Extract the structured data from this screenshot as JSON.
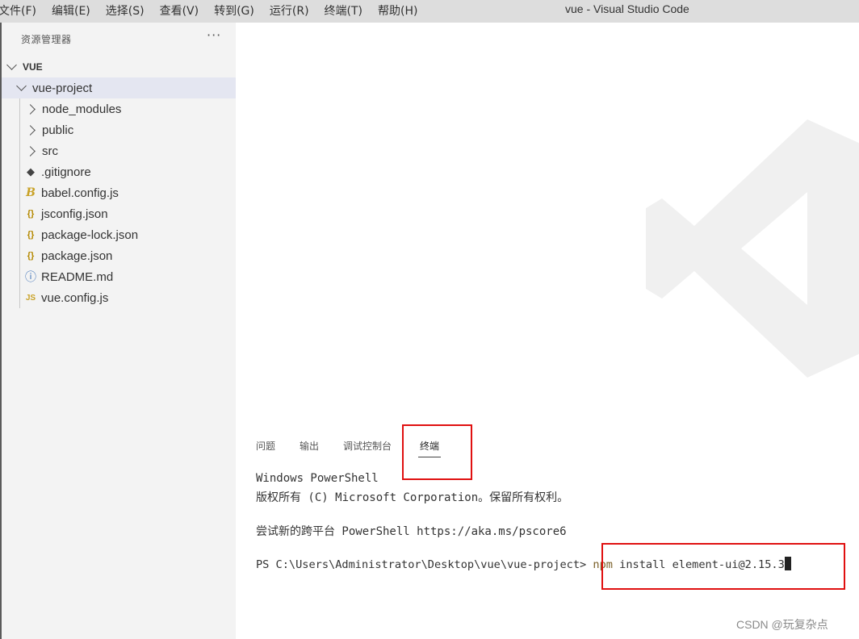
{
  "menu": {
    "items": [
      "文件(F)",
      "编辑(E)",
      "选择(S)",
      "查看(V)",
      "转到(G)",
      "运行(R)",
      "终端(T)",
      "帮助(H)"
    ],
    "window_title": "vue - Visual Studio Code"
  },
  "sidebar": {
    "title": "资源管理器",
    "more": "···",
    "workspace": "VUE",
    "tree": [
      {
        "label": "vue-project",
        "kind": "folder",
        "expanded": true,
        "selected": true
      },
      {
        "label": "node_modules",
        "kind": "folder",
        "expanded": false
      },
      {
        "label": "public",
        "kind": "folder",
        "expanded": false
      },
      {
        "label": "src",
        "kind": "folder",
        "expanded": false
      },
      {
        "label": ".gitignore",
        "kind": "file",
        "icon": "git-diamond-icon",
        "glyph": "◆"
      },
      {
        "label": "babel.config.js",
        "kind": "file",
        "icon": "babel-icon",
        "glyph": "B"
      },
      {
        "label": "jsconfig.json",
        "kind": "file",
        "icon": "json-braces-icon",
        "glyph": "{}"
      },
      {
        "label": "package-lock.json",
        "kind": "file",
        "icon": "json-braces-icon",
        "glyph": "{}"
      },
      {
        "label": "package.json",
        "kind": "file",
        "icon": "json-braces-icon",
        "glyph": "{}"
      },
      {
        "label": "README.md",
        "kind": "file",
        "icon": "info-icon",
        "glyph": "ⓘ"
      },
      {
        "label": "vue.config.js",
        "kind": "file",
        "icon": "js-icon",
        "glyph": "JS"
      }
    ]
  },
  "panel": {
    "tabs": [
      "问题",
      "输出",
      "调试控制台",
      "终端"
    ],
    "active_tab": "终端"
  },
  "terminal": {
    "lines": [
      "Windows PowerShell",
      "版权所有 (C) Microsoft Corporation。保留所有权利。",
      "尝试新的跨平台 PowerShell https://aka.ms/pscore6"
    ],
    "prompt": "PS C:\\Users\\Administrator\\Desktop\\vue\\vue-project>",
    "cmd_npm": "npm",
    "cmd_rest": " install element-ui@2.15.3"
  },
  "colors": {
    "highlight": "#e01010",
    "npm": "#795e26"
  },
  "watermark": "CSDN @玩复杂点"
}
